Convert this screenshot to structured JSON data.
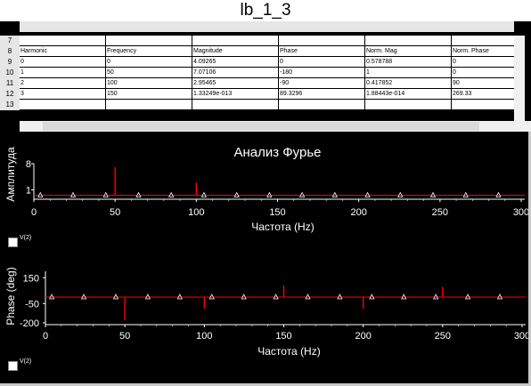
{
  "window": {
    "title": "lb_1_3"
  },
  "sheet": {
    "row_numbers": [
      "7",
      "8",
      "9",
      "10",
      "11",
      "12",
      "13"
    ],
    "headers": [
      "Harmonic",
      "Frequency",
      "Magnitude",
      "Phase",
      "Norm. Mag",
      "Norm. Phase"
    ],
    "rows": [
      [
        "0",
        "0",
        "4.09265",
        "0",
        "0.578788",
        "0"
      ],
      [
        "1",
        "50",
        "7.07106",
        "-180",
        "1",
        "0"
      ],
      [
        "2",
        "100",
        "2.95465",
        "-90",
        "0.417852",
        "90"
      ],
      [
        "3",
        "150",
        "1.33249e-013",
        "89.3296",
        "1.88443e-014",
        "269.33"
      ]
    ]
  },
  "colors": {
    "trace": "#ff0000",
    "axes": "#ffffff",
    "background": "#000000",
    "marker": "#ffffff"
  },
  "chart_data": [
    {
      "type": "bar",
      "title": "Анализ Фурье",
      "xlabel": "Частота (Hz)",
      "ylabel": "Амплитуда",
      "xlim": [
        0,
        300
      ],
      "ylim": [
        -1,
        8
      ],
      "x_ticks": [
        "0",
        "50",
        "100",
        "150",
        "200",
        "250",
        "300"
      ],
      "y_ticks": [
        "8",
        "1"
      ],
      "series": [
        {
          "name": "V(2)",
          "x": [
            0,
            50,
            100,
            150,
            200,
            250,
            300
          ],
          "values": [
            0,
            7.07,
            2.95,
            0,
            0,
            0,
            0
          ]
        }
      ],
      "legend": {
        "label": "V(2)",
        "placement": "bottom-left",
        "checked": true
      }
    },
    {
      "type": "bar",
      "title": "",
      "xlabel": "Частота (Hz)",
      "ylabel": "Phase (deg)",
      "xlim": [
        0,
        300
      ],
      "ylim": [
        -200,
        200
      ],
      "x_ticks": [
        "0",
        "50",
        "100",
        "150",
        "200",
        "250",
        "300"
      ],
      "y_ticks": [
        "150",
        "-50",
        "-200"
      ],
      "series": [
        {
          "name": "V(2)",
          "x": [
            0,
            50,
            100,
            150,
            200,
            250,
            300
          ],
          "values": [
            0,
            -180,
            -90,
            89.33,
            -90,
            80,
            0
          ]
        }
      ],
      "legend": {
        "label": "V(2)",
        "placement": "bottom-left",
        "checked": true
      }
    }
  ]
}
